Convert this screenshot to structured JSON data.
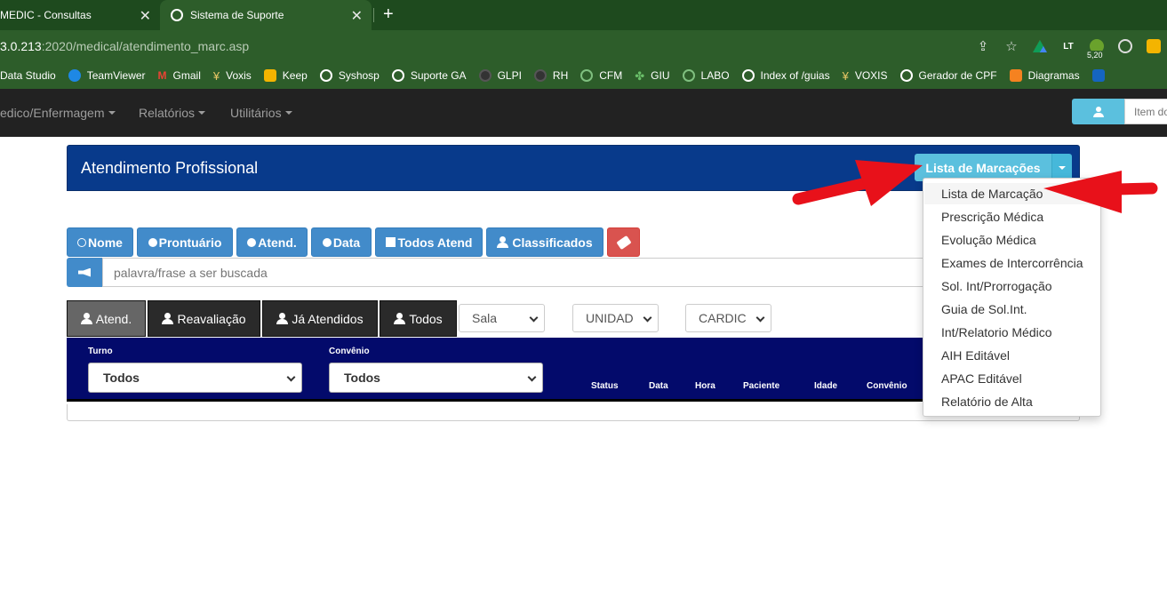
{
  "browser": {
    "tabs": [
      {
        "title": "MEDIC - Consultas",
        "active": true
      },
      {
        "title": "Sistema de Suporte",
        "active": false
      }
    ],
    "new_tab": "+",
    "close": "✕",
    "url_host": "3.0.213",
    "url_rest": ":2020/medical/atendimento_marc.asp",
    "badge_value": "5,20",
    "bookmarks": [
      "Data Studio",
      "TeamViewer",
      "Gmail",
      "Voxis",
      "Keep",
      "Syshosp",
      "Suporte GA",
      "GLPI",
      "RH",
      "CFM",
      "GIU",
      "LABO",
      "Index of /guias",
      "VOXIS",
      "Gerador de CPF",
      "Diagramas"
    ]
  },
  "nav": {
    "menu1": "edico/Enfermagem",
    "menu2": "Relatórios",
    "menu3": "Utilitários",
    "item_placeholder": "Item do"
  },
  "panel": {
    "title": "Atendimento Profissional",
    "split_label": "Lista de Marcações"
  },
  "filters": {
    "nome": "Nome",
    "prontuario": "Prontuário",
    "atend": "Atend.",
    "data": "Data",
    "todos_atend": "Todos Atend",
    "classificados": "Classificados",
    "search_placeholder": "palavra/frase a ser buscada"
  },
  "tabs": {
    "atend": "Atend.",
    "reavaliacao": "Reavaliação",
    "ja_atendidos": "Já Atendidos",
    "todos": "Todos"
  },
  "selects": {
    "sala": "Sala",
    "unidade": "UNIDAD",
    "cardio": "CARDIC"
  },
  "table": {
    "turno_label": "Turno",
    "turno_value": "Todos",
    "convenio_label": "Convênio",
    "convenio_value": "Todos",
    "columns": [
      "Status",
      "Data",
      "Hora",
      "Paciente",
      "Idade",
      "Convênio"
    ]
  },
  "dropdown": {
    "items": [
      "Lista de Marcação",
      "Prescrição Médica",
      "Evolução Médica",
      "Exames de Intercorrência",
      "Sol. Int/Prorrogação",
      "Guia de Sol.Int.",
      "Int/Relatorio Médico",
      "AIH Editável",
      "APAC Editável",
      "Relatório de Alta"
    ]
  },
  "colors": {
    "panel_blue": "#083a8b",
    "info": "#5bc0de",
    "primary": "#428bca",
    "danger": "#d9534f",
    "annotation_arrow": "#e8111a"
  }
}
